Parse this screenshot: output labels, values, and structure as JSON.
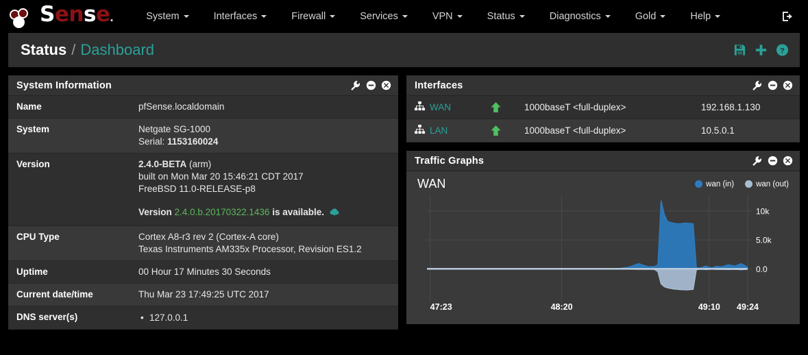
{
  "brand": {
    "name": "Sense",
    "logo_icon": "pfsense-logo"
  },
  "navbar": {
    "items": [
      {
        "label": "System",
        "icon": "chevron-down-icon"
      },
      {
        "label": "Interfaces",
        "icon": "chevron-down-icon"
      },
      {
        "label": "Firewall",
        "icon": "chevron-down-icon"
      },
      {
        "label": "Services",
        "icon": "chevron-down-icon"
      },
      {
        "label": "VPN",
        "icon": "chevron-down-icon"
      },
      {
        "label": "Status",
        "icon": "chevron-down-icon"
      },
      {
        "label": "Diagnostics",
        "icon": "chevron-down-icon"
      },
      {
        "label": "Gold",
        "icon": "chevron-down-icon"
      },
      {
        "label": "Help",
        "icon": "chevron-down-icon"
      }
    ],
    "logout_icon": "logout-icon"
  },
  "breadcrumb": {
    "parent": "Status",
    "separator": "/",
    "current": "Dashboard",
    "actions": [
      {
        "name": "save-settings",
        "icon": "floppy-disk-icon"
      },
      {
        "name": "add-widget",
        "icon": "plus-icon"
      },
      {
        "name": "help",
        "icon": "question-circle-icon"
      }
    ]
  },
  "colors": {
    "accent_teal": "#2aa198",
    "green_link": "#5cb85c",
    "arrow_green": "#4fbf5f",
    "wan_in": "#2b7cc0",
    "wan_out": "#a8bdd4",
    "panel_bg": "#2f2f2f",
    "panel_head": "#333333",
    "logo_red": "#8c1114"
  },
  "system_information": {
    "title": "System Information",
    "head_icons": [
      {
        "name": "configure",
        "icon": "wrench-icon"
      },
      {
        "name": "minimize",
        "icon": "minus-circle-icon"
      },
      {
        "name": "close",
        "icon": "times-circle-icon"
      }
    ],
    "rows": [
      {
        "label": "Name",
        "lines": [
          "pfSense.localdomain"
        ]
      },
      {
        "label": "System",
        "lines": [
          "Netgate SG-1000",
          "Serial: 1153160024"
        ],
        "bold_tail": "1153160024"
      },
      {
        "label": "Version",
        "lines": [
          "2.4.0-BETA (arm)",
          "built on Mon Mar 20 15:46:21 CDT 2017",
          "FreeBSD 11.0-RELEASE-p8"
        ],
        "version_bold": "2.4.0-BETA",
        "version_arch": "(arm)",
        "update_prefix": "Version",
        "update_version": "2.4.0.b.20170322.1436",
        "update_suffix": "is available.",
        "update_icon": "cloud-download-icon"
      },
      {
        "label": "CPU Type",
        "lines": [
          "Cortex A8-r3 rev 2 (Cortex-A core)",
          "Texas Instruments AM335x Processor, Revision ES1.2"
        ]
      },
      {
        "label": "Uptime",
        "lines": [
          "00 Hour 17 Minutes 30 Seconds"
        ]
      },
      {
        "label": "Current date/time",
        "lines": [
          "Thu Mar 23 17:49:25 UTC 2017"
        ]
      },
      {
        "label": "DNS server(s)",
        "dns": [
          "127.0.0.1"
        ]
      }
    ]
  },
  "interfaces": {
    "title": "Interfaces",
    "head_icons": [
      {
        "name": "configure",
        "icon": "wrench-icon"
      },
      {
        "name": "minimize",
        "icon": "minus-circle-icon"
      },
      {
        "name": "close",
        "icon": "times-circle-icon"
      }
    ],
    "rows": [
      {
        "name": "WAN",
        "icon": "sitemap-icon",
        "status_icon": "arrow-up-icon",
        "media": "1000baseT <full-duplex>",
        "ip": "192.168.1.130"
      },
      {
        "name": "LAN",
        "icon": "sitemap-icon",
        "status_icon": "arrow-up-icon",
        "media": "1000baseT <full-duplex>",
        "ip": "10.5.0.1"
      }
    ]
  },
  "traffic_graphs": {
    "title": "Traffic Graphs",
    "head_icons": [
      {
        "name": "configure",
        "icon": "wrench-icon"
      },
      {
        "name": "minimize",
        "icon": "minus-circle-icon"
      },
      {
        "name": "close",
        "icon": "times-circle-icon"
      }
    ],
    "graph_label": "WAN",
    "legend": [
      {
        "label": "wan (in)",
        "color": "#2b7cc0"
      },
      {
        "label": "wan (out)",
        "color": "#a8bdd4"
      }
    ]
  },
  "chart_data": {
    "type": "area",
    "title": "WAN",
    "xlabel": "",
    "ylabel": "",
    "ytick_labels": [
      "10k",
      "5.0k",
      "0.0"
    ],
    "ytick_values": [
      10000,
      5000,
      0
    ],
    "ylim": [
      -4000,
      12000
    ],
    "xtick_labels": [
      "47:23",
      "48:20",
      "49:10",
      "49:24"
    ],
    "grid": true,
    "legend_position": "top-right",
    "series": [
      {
        "name": "wan (in)",
        "color": "#2b7cc0",
        "x": [
          0,
          6,
          12,
          18,
          24,
          30,
          36,
          42,
          48,
          54,
          60,
          63,
          66,
          69,
          71,
          72,
          73,
          74,
          75,
          76,
          77,
          78,
          79,
          80,
          81,
          82,
          83,
          84,
          85,
          86,
          87,
          88,
          89,
          90,
          92,
          94,
          96,
          98,
          100
        ],
        "values": [
          40,
          30,
          35,
          30,
          40,
          30,
          35,
          30,
          40,
          35,
          60,
          300,
          900,
          350,
          420,
          700,
          11800,
          9400,
          8200,
          8000,
          7900,
          7800,
          7800,
          7900,
          7900,
          7850,
          7800,
          200,
          120,
          300,
          500,
          250,
          180,
          420,
          380,
          700,
          500,
          900,
          300
        ]
      },
      {
        "name": "wan (out)",
        "color": "#a8bdd4",
        "x": [
          0,
          6,
          12,
          18,
          24,
          30,
          36,
          42,
          48,
          54,
          60,
          63,
          66,
          69,
          71,
          72,
          73,
          74,
          75,
          76,
          77,
          78,
          79,
          80,
          81,
          82,
          83,
          84,
          85,
          86,
          87,
          88,
          89,
          90,
          92,
          94,
          96,
          98,
          100
        ],
        "values": [
          -20,
          -15,
          -20,
          -15,
          -20,
          -15,
          -20,
          -15,
          -20,
          -15,
          -30,
          -60,
          -100,
          -80,
          -120,
          -500,
          -2600,
          -3100,
          -3300,
          -3400,
          -3500,
          -3550,
          -3600,
          -3620,
          -3650,
          -3600,
          -3550,
          -150,
          -80,
          -100,
          -120,
          -90,
          -70,
          -110,
          -100,
          -120,
          -100,
          -150,
          -80
        ]
      }
    ]
  }
}
